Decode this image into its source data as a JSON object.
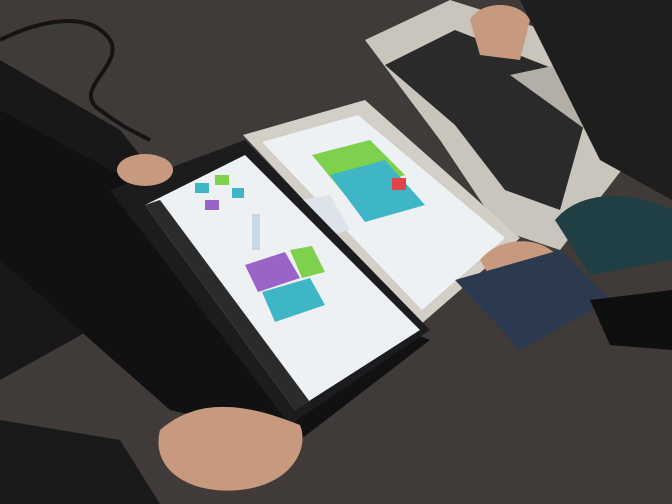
{
  "scene": {
    "subject": "photo",
    "objects": [
      {
        "name": "windows-laptop",
        "screen": "floor-plan-app"
      },
      {
        "name": "macbook",
        "screen": "floor-plan-app"
      }
    ]
  },
  "colors": {
    "floor": "#3b3733",
    "laptop_body": "#1c1c1e",
    "screen": "#eef1f4",
    "mac_body": "#c9c5bd",
    "plan_green": "#7ed04d",
    "plan_teal": "#3fb6c6",
    "plan_purple": "#9a63c8",
    "plan_red": "#e04646",
    "skin": "#c79a7f",
    "sleeve": "#1f3f45"
  }
}
